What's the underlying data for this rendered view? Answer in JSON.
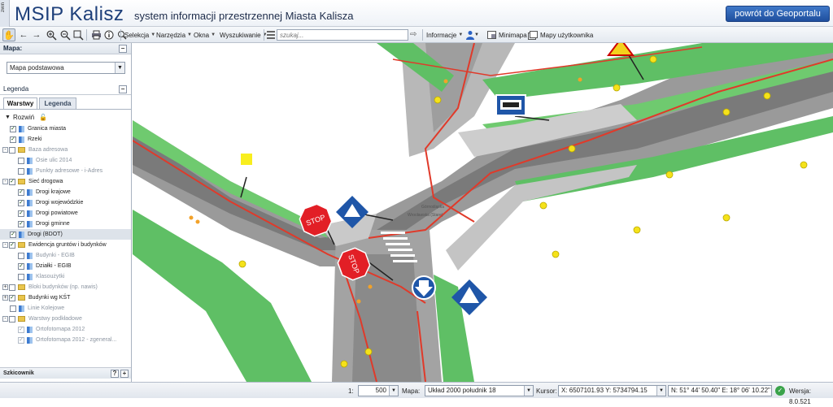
{
  "header": {
    "collapse_label": "zwiń",
    "app_title": "MSIP Kalisz",
    "app_subtitle": "system informacji przestrzennej Miasta Kalisza",
    "portal_button": "powrót do Geoportalu"
  },
  "toolbar": {
    "menus": [
      "Selekcja",
      "Narzędzia",
      "Okna",
      "Wyszukiwanie"
    ],
    "search_placeholder": "szukaj...",
    "info_menu": "Informacje",
    "minimap": "Minimapa",
    "user_maps": "Mapy użytkownika"
  },
  "left_panel": {
    "map_header": "Mapa:",
    "basemap_value": "Mapa podstawowa",
    "legend_header": "Legenda",
    "tabs": [
      "Warstwy",
      "Legenda"
    ],
    "expand_label": "Rozwiń",
    "layers": [
      {
        "label": "Granica miasta",
        "checked": true,
        "type": "layer",
        "indent": 0,
        "active": true
      },
      {
        "label": "Rzeki",
        "checked": true,
        "type": "layer",
        "indent": 0,
        "active": true
      },
      {
        "label": "Baza adresowa",
        "checked": false,
        "type": "folder",
        "indent": 0,
        "active": false,
        "expander": "-"
      },
      {
        "label": "Osie ulic 2014",
        "checked": false,
        "type": "layer",
        "indent": 1,
        "active": false
      },
      {
        "label": "Punkty adresowe - i-Adres",
        "checked": false,
        "type": "layer",
        "indent": 1,
        "active": false
      },
      {
        "label": "Sieć drogowa",
        "checked": true,
        "type": "folder",
        "indent": 0,
        "active": true,
        "expander": "-"
      },
      {
        "label": "Drogi krajowe",
        "checked": true,
        "type": "layer",
        "indent": 1,
        "active": true
      },
      {
        "label": "Drogi wojewódzkie",
        "checked": true,
        "type": "layer",
        "indent": 1,
        "active": true
      },
      {
        "label": "Drogi powiatowe",
        "checked": true,
        "type": "layer",
        "indent": 1,
        "active": true
      },
      {
        "label": "Drogi gminne",
        "checked": true,
        "type": "layer",
        "indent": 1,
        "active": true
      },
      {
        "label": "Drogi (BDOT)",
        "checked": true,
        "type": "layer",
        "indent": 0,
        "active": true,
        "selected": true
      },
      {
        "label": "Ewidencja gruntów i budynków",
        "checked": true,
        "type": "folder",
        "indent": 0,
        "active": true,
        "expander": "-"
      },
      {
        "label": "Budynki - EGIB",
        "checked": false,
        "type": "layer",
        "indent": 1,
        "active": false
      },
      {
        "label": "Działki - EGIB",
        "checked": true,
        "type": "layer",
        "indent": 1,
        "active": true
      },
      {
        "label": "Klasoużytki",
        "checked": false,
        "type": "layer",
        "indent": 1,
        "active": false
      },
      {
        "label": "Bloki budynków (np. nawis)",
        "checked": false,
        "type": "folder",
        "indent": 0,
        "active": false,
        "expander": "+"
      },
      {
        "label": "Budynki wg KŚT",
        "checked": true,
        "type": "folder",
        "indent": 0,
        "active": true,
        "expander": "+"
      },
      {
        "label": "Linie Kolejowe",
        "checked": false,
        "type": "layer",
        "indent": 0,
        "active": false
      },
      {
        "label": "Warstwy podkładowe",
        "checked": false,
        "type": "folder",
        "indent": 0,
        "active": false,
        "expander": "-"
      },
      {
        "label": "Ortofotomapa 2012",
        "checked": true,
        "type": "layer",
        "indent": 1,
        "active": false,
        "grey_check": true
      },
      {
        "label": "Ortofotomapa 2012 - zgeneral...",
        "checked": true,
        "type": "layer",
        "indent": 1,
        "active": false,
        "grey_check": true
      }
    ],
    "sketch_header": "Szkicownik"
  },
  "map": {
    "street_label_1": "Górnośląska",
    "street_label_2": "Wrocławska (Stare)",
    "stop_text": "STOP"
  },
  "status": {
    "scale_prefix": "1:",
    "scale_value": "500",
    "map_label": "Mapa:",
    "crs_value": "Układ 2000 południk 18",
    "cursor_label": "Kursor:",
    "cursor_xy": "X: 6507101.93  Y: 5734794.15",
    "cursor_geo": "N: 51° 44' 50.40\" E: 18° 06' 10.22\"",
    "version": "Wersja: 8.0.521"
  }
}
